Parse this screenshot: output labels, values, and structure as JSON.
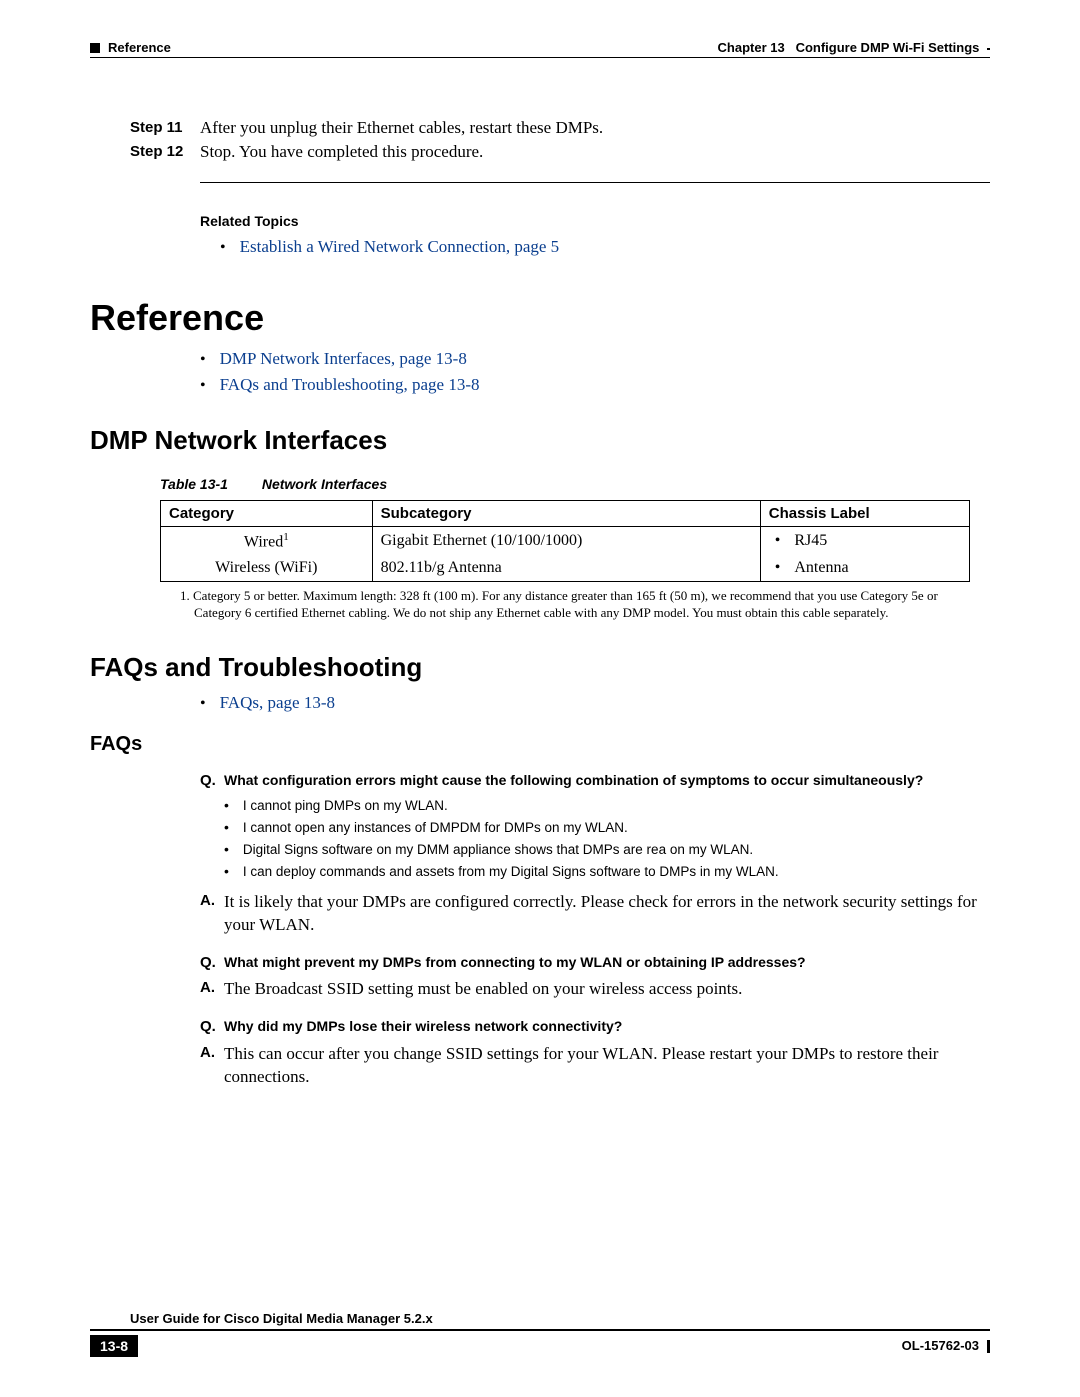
{
  "header": {
    "section": "Reference",
    "chapter_label": "Chapter 13",
    "chapter_title": "Configure DMP Wi-Fi Settings"
  },
  "steps": [
    {
      "label": "Step 11",
      "text": "After you unplug their Ethernet cables, restart these DMPs."
    },
    {
      "label": "Step 12",
      "text": "Stop. You have completed this procedure."
    }
  ],
  "related_topics_heading": "Related Topics",
  "related_topics": [
    "Establish a Wired Network Connection, page 5"
  ],
  "h1": "Reference",
  "ref_toc": [
    "DMP Network Interfaces, page 13-8",
    "FAQs and Troubleshooting, page 13-8"
  ],
  "h2_interfaces": "DMP Network Interfaces",
  "table": {
    "caption_num": "Table 13-1",
    "caption_title": "Network Interfaces",
    "headers": [
      "Category",
      "Subcategory",
      "Chassis Label"
    ],
    "rows": [
      {
        "c1": "Wired",
        "c1_sup": "1",
        "c2": "Gigabit Ethernet (10/100/1000)",
        "c3": "RJ45"
      },
      {
        "c1": "Wireless (WiFi)",
        "c1_sup": "",
        "c2": "802.11b/g Antenna",
        "c3": "Antenna"
      }
    ],
    "footnote": "1. Category 5 or better. Maximum length: 328 ft (100 m). For any distance greater than 165 ft (50 m), we recommend that you use Category 5e or Category 6 certified Ethernet cabling. We do not ship any Ethernet cable with any DMP model. You must obtain this cable separately."
  },
  "h2_faqs_trouble": "FAQs and Troubleshooting",
  "faqs_toc": [
    "FAQs, page 13-8"
  ],
  "h3_faqs": "FAQs",
  "qa": [
    {
      "q": "What configuration errors might cause the following combination of symptoms to occur simultaneously?",
      "sub": [
        "I cannot ping DMPs on my WLAN.",
        "I cannot open any instances of DMPDM for DMPs on my WLAN.",
        "Digital Signs software on my DMM appliance shows that DMPs are rea on my WLAN.",
        "I can deploy commands and assets from my Digital Signs software to DMPs in my WLAN."
      ],
      "a": "It is likely that your DMPs are configured correctly. Please check for errors in the network security settings for your WLAN."
    },
    {
      "q": "What might prevent my DMPs from connecting to my WLAN or obtaining IP addresses?",
      "a": "The Broadcast SSID setting must be enabled on your wireless access points."
    },
    {
      "q": "Why did my DMPs lose their wireless network connectivity?",
      "a": "This can occur after you change SSID settings for your WLAN. Please restart your DMPs to restore their connections."
    }
  ],
  "footer": {
    "title": "User Guide for Cisco Digital Media Manager 5.2.x",
    "page": "13-8",
    "doc": "OL-15762-03"
  }
}
